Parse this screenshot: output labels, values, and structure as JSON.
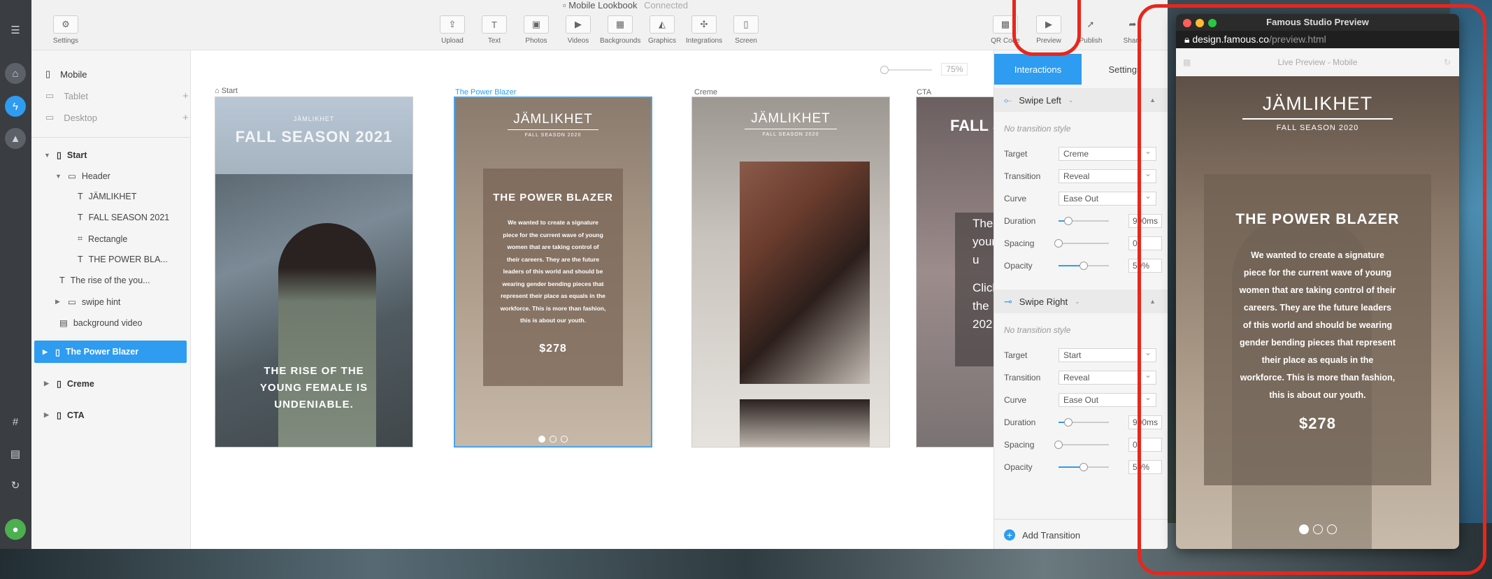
{
  "app": {
    "doc_title": "Mobile Lookbook",
    "status": "Connected",
    "settings_label": "Settings"
  },
  "toolbar": {
    "upload": "Upload",
    "text": "Text",
    "photos": "Photos",
    "videos": "Videos",
    "backgrounds": "Backgrounds",
    "graphics": "Graphics",
    "integrations": "Integrations",
    "screen": "Screen",
    "qr_code": "QR Code",
    "preview": "Preview",
    "publish": "Publish",
    "share": "Share"
  },
  "sidebar": {
    "devices": [
      "Mobile",
      "Tablet",
      "Desktop"
    ],
    "tree": {
      "start": "Start",
      "header": "Header",
      "jamlikhet": "JÄMLIKHET",
      "fall_season": "FALL SEASON 2021",
      "rectangle": "Rectangle",
      "power_bla": "THE POWER BLA...",
      "rise": "The rise of the you...",
      "swipe_hint": "swipe hint",
      "background_video": "background video",
      "power_blazer": "The Power Blazer",
      "creme": "Creme",
      "cta": "CTA"
    }
  },
  "canvas": {
    "zoom": "75%",
    "frame_labels": [
      "Start",
      "The Power Blazer",
      "Creme",
      "CTA"
    ],
    "start": {
      "brand": "JÄMLIKHET",
      "season": "FALL SEASON 2021",
      "headline": "THE RISE OF THE YOUNG FEMALE IS UNDENIABLE."
    },
    "power": {
      "brand": "JÄMLIKHET",
      "season": "FALL SEASON 2020",
      "headline": "THE POWER BLAZER",
      "body": "We wanted to create a signature piece for the current wave of young women that are taking control of their careers. They are the future leaders of this world and should be wearing gender bending pieces that represent their place as equals in the workforce. This is more than fashion, this is about our youth.",
      "price": "$278"
    },
    "creme": {
      "brand": "JÄMLIKHET",
      "season": "FALL SEASON 2020"
    },
    "cta": {
      "title": "FALL S",
      "lines": [
        "The",
        "your",
        "u",
        "Click",
        "the",
        "202"
      ]
    }
  },
  "interactions": {
    "tabs": [
      "Interactions",
      "Settings"
    ],
    "swipe_left": {
      "title": "Swipe Left",
      "note": "No transition style",
      "target": "Creme",
      "transition": "Reveal",
      "curve": "Ease Out",
      "duration": "900ms",
      "spacing": "0",
      "opacity": "50%",
      "duration_level": 0.2,
      "spacing_level": 0.0,
      "opacity_level": 0.5
    },
    "swipe_right": {
      "title": "Swipe Right",
      "note": "No transition style",
      "target": "Start",
      "transition": "Reveal",
      "curve": "Ease Out",
      "duration": "900ms",
      "spacing": "0",
      "opacity": "50%",
      "duration_level": 0.2,
      "spacing_level": 0.0,
      "opacity_level": 0.5
    },
    "labels": {
      "target": "Target",
      "transition": "Transition",
      "curve": "Curve",
      "duration": "Duration",
      "spacing": "Spacing",
      "opacity": "Opacity"
    },
    "add_transition": "Add Transition"
  },
  "preview": {
    "window_title": "Famous Studio Preview",
    "url_host": "design.famous.co",
    "url_path": "/preview.html",
    "header": "Live Preview - Mobile",
    "brand": "JÄMLIKHET",
    "season": "FALL SEASON 2020",
    "headline": "THE POWER BLAZER",
    "body": "We wanted to create a signature piece for the current wave of young women that are taking control of their careers. They are the future leaders of this world and should be wearing gender bending pieces that represent their place as equals in the workforce. This is more than fashion, this is about our youth.",
    "price": "$278"
  },
  "colors": {
    "accent": "#2e9cf0",
    "highlight": "#e8261c",
    "rail": "#3a3d42"
  }
}
